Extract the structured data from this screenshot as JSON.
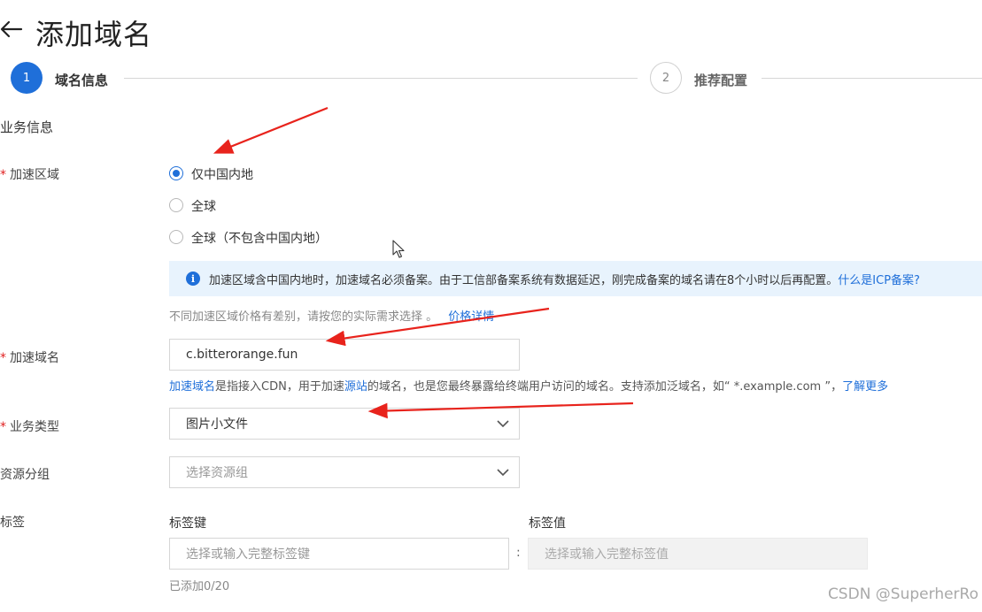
{
  "header": {
    "title": "添加域名"
  },
  "steps": [
    {
      "number": "1",
      "label": "域名信息"
    },
    {
      "number": "2",
      "label": "推荐配置"
    }
  ],
  "section": {
    "title": "业务信息"
  },
  "accel_region": {
    "required_mark": "*",
    "label": "加速区域",
    "options": [
      "仅中国内地",
      "全球",
      "全球（不包含中国内地）"
    ],
    "selected": "仅中国内地"
  },
  "info": {
    "icon": "i",
    "text": "加速区域含中国内地时，加速域名必须备案。由于工信部备案系统有数据延迟，刚完成备案的域名请在8个小时以后再配置。",
    "link": "什么是ICP备案?"
  },
  "price": {
    "hint": "不同加速区域价格有差别，请按您的实际需求选择 。",
    "link": "价格详情"
  },
  "domain": {
    "required_mark": "*",
    "label": "加速域名",
    "value": "c.bitterorange.fun",
    "hint_link1": "加速域名",
    "hint_text1": "是指接入CDN，用于加速",
    "hint_link2": "源站",
    "hint_text2": "的域名，也是您最终暴露给终端用户访问的域名。支持添加泛域名，如“ *.example.com ”，",
    "hint_link3": "了解更多"
  },
  "business_type": {
    "required_mark": "*",
    "label": "业务类型",
    "value": "图片小文件"
  },
  "resource_group": {
    "label": "资源分组",
    "placeholder": "选择资源组"
  },
  "tags": {
    "label": "标签",
    "key_header": "标签键",
    "value_header": "标签值",
    "key_placeholder": "选择或输入完整标签键",
    "separator": ":",
    "value_placeholder": "选择或输入完整标签值",
    "count": "已添加0/20"
  },
  "watermark": "CSDN @SuperherRo",
  "colors": {
    "accent": "#1f6fd9",
    "arrow": "#e8231c",
    "info_bg": "#e8f3fd"
  }
}
